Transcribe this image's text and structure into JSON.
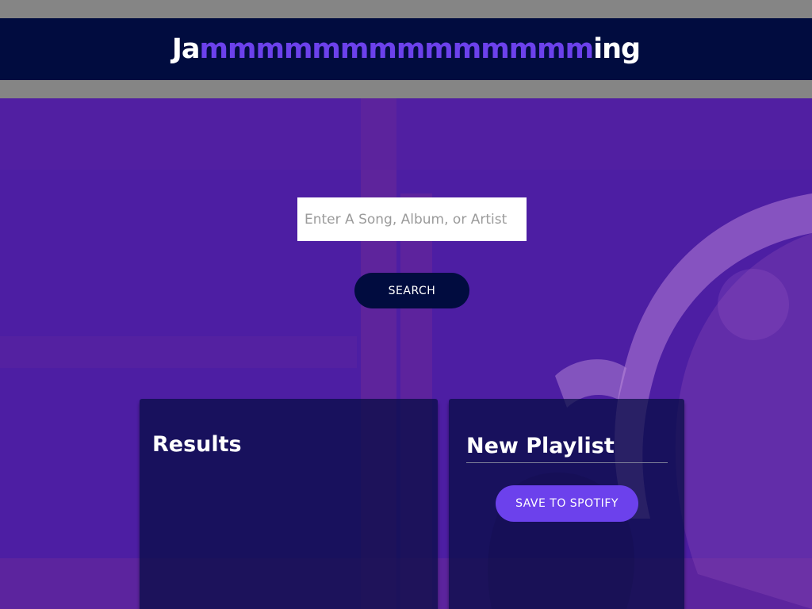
{
  "header": {
    "logo_prefix": "Ja",
    "logo_highlight": "mmmmmmmmmmmmmm",
    "logo_suffix": "ing"
  },
  "search": {
    "placeholder": "Enter A Song, Album, or Artist",
    "value": "",
    "button_label": "SEARCH"
  },
  "results": {
    "title": "Results",
    "tracks": []
  },
  "playlist": {
    "name": "New Playlist",
    "save_label": "SAVE TO SPOTIFY",
    "tracks": []
  },
  "colors": {
    "header_bg": "#010c3f",
    "accent": "#6c41ec",
    "background_tint": "#4b1d9e",
    "strip": "#858585"
  }
}
